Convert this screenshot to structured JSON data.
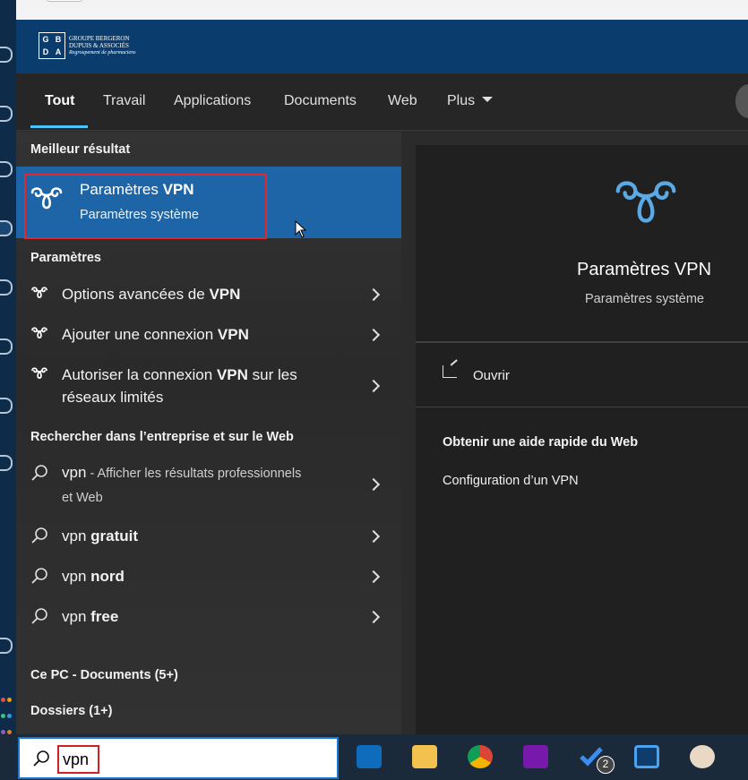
{
  "brand": {
    "logo_letters": [
      "G",
      "B",
      "D",
      "A"
    ],
    "logo_text_lines": [
      "GROUPE BERGERON",
      "DUPUIS & ASSOCIÉS",
      "Regroupement de pharmaciens"
    ]
  },
  "tabs": [
    {
      "label": "Tout",
      "active": true
    },
    {
      "label": "Travail"
    },
    {
      "label": "Applications"
    },
    {
      "label": "Documents"
    },
    {
      "label": "Web"
    },
    {
      "label": "Plus"
    }
  ],
  "results": {
    "best_header": "Meilleur résultat",
    "best": {
      "title_plain": "Paramètres ",
      "title_bold": "VPN",
      "subtitle": "Paramètres système",
      "icon": "vpn-icon"
    },
    "settings_header": "Paramètres",
    "settings": [
      {
        "plain": "Options avancées de ",
        "bold": "VPN",
        "tail": "",
        "line2": ""
      },
      {
        "plain": "Ajouter une connexion ",
        "bold": "VPN",
        "tail": "",
        "line2": ""
      },
      {
        "plain": "Autoriser la connexion ",
        "bold": "VPN",
        "tail": " sur les",
        "line2": "réseaux limités"
      }
    ],
    "web_header": "Rechercher dans l’entreprise et sur le Web",
    "web": [
      {
        "query": "vpn",
        "bold": "",
        "dim": " - Afficher les résultats professionnels",
        "line2": "et Web"
      },
      {
        "query": "vpn ",
        "bold": "gratuit"
      },
      {
        "query": "vpn ",
        "bold": "nord"
      },
      {
        "query": "vpn ",
        "bold": "free"
      }
    ],
    "pc_docs": "Ce PC - Documents (5+)",
    "folders": "Dossiers (1+)"
  },
  "detail": {
    "title": "Paramètres VPN",
    "subtitle": "Paramètres système",
    "open_label": "Ouvrir",
    "help_header": "Obtenir une aide rapide du Web",
    "help_link": "Configuration d’un VPN"
  },
  "search": {
    "value": "vpn"
  },
  "taskbar": {
    "apps": [
      "outlook-icon",
      "file-explorer-icon",
      "chrome-icon",
      "onenote-icon",
      "todo-icon",
      "remote-desktop-icon",
      "paint-icon"
    ],
    "todo_badge": "2"
  },
  "colors": {
    "accent": "#1e65a8",
    "highlight": "#e3272d",
    "brand_bar": "#0a3d6e",
    "tab_underline": "#4cc2ff"
  }
}
